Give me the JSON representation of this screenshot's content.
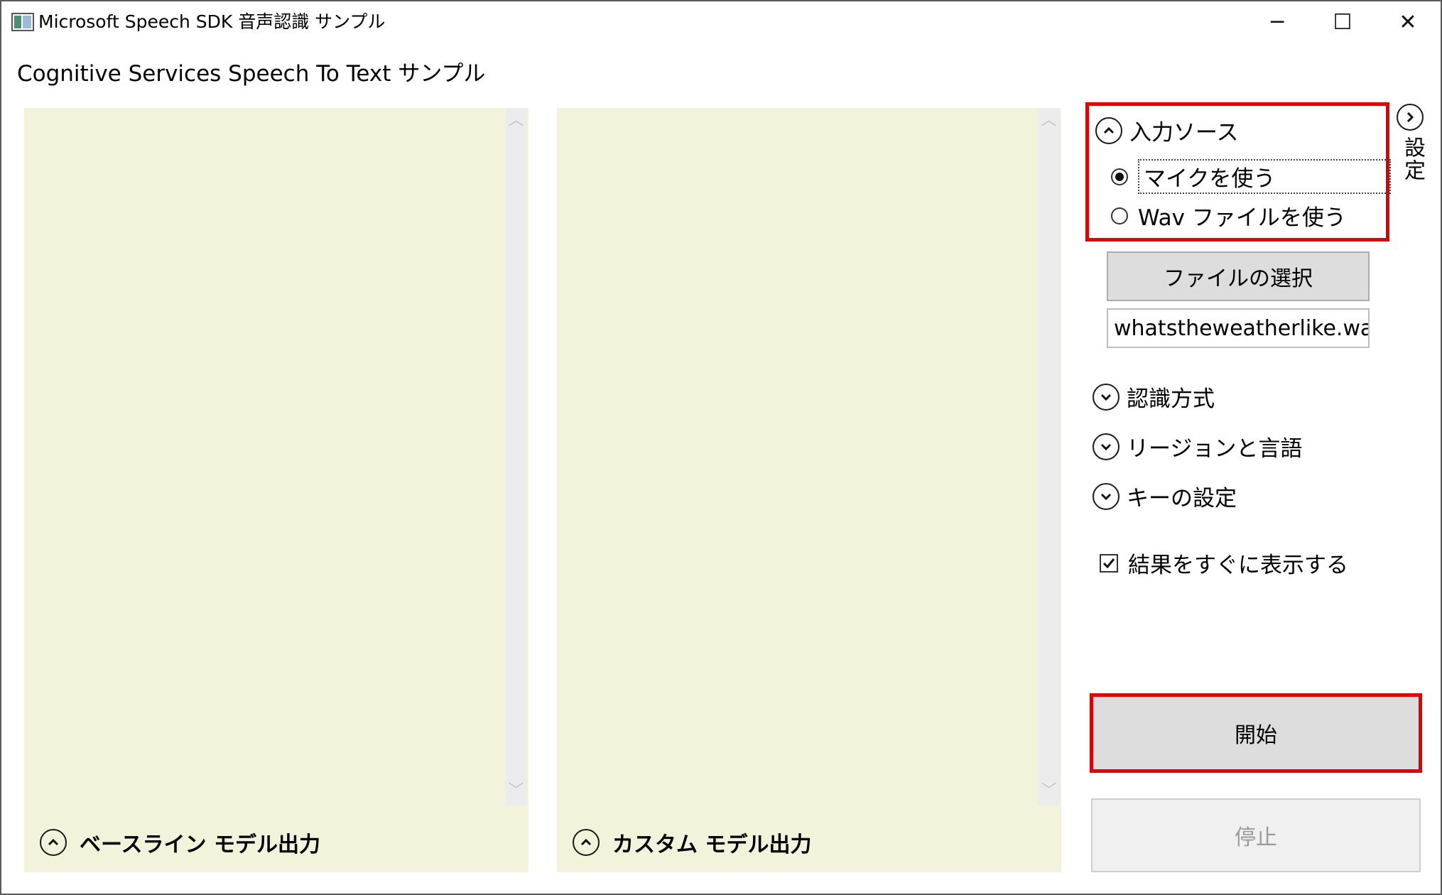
{
  "window": {
    "title": "Microsoft Speech SDK 音声認識 サンプル",
    "controls": {
      "minimize": "─",
      "maximize": "☐",
      "close": "✕"
    }
  },
  "header": {
    "subtitle": "Cognitive Services Speech To Text サンプル"
  },
  "panels": {
    "baseline": {
      "label": "ベースライン モデル出力",
      "icon": "chevron-up-icon"
    },
    "custom": {
      "label": "カスタム モデル出力",
      "icon": "chevron-up-icon"
    },
    "scroll_up": "︿",
    "scroll_down": "﹀"
  },
  "settings": {
    "toggle_label": "設定",
    "input_source": {
      "header": "入力ソース",
      "options": [
        {
          "label": "マイクを使う",
          "selected": true
        },
        {
          "label": "Wav ファイルを使う",
          "selected": false
        }
      ]
    },
    "select_file_button": "ファイルの選択",
    "file_name": "whatstheweatherlike.wav",
    "collapsed_groups": [
      "認識方式",
      "リージョンと言語",
      "キーの設定"
    ],
    "show_results_immediately": {
      "label": "結果をすぐに表示する",
      "checked": true
    }
  },
  "actions": {
    "start": "開始",
    "stop": "停止"
  },
  "colors": {
    "panel_bg": "#f3f3dc",
    "highlight": "#e00000",
    "button_bg": "#dddddd"
  }
}
